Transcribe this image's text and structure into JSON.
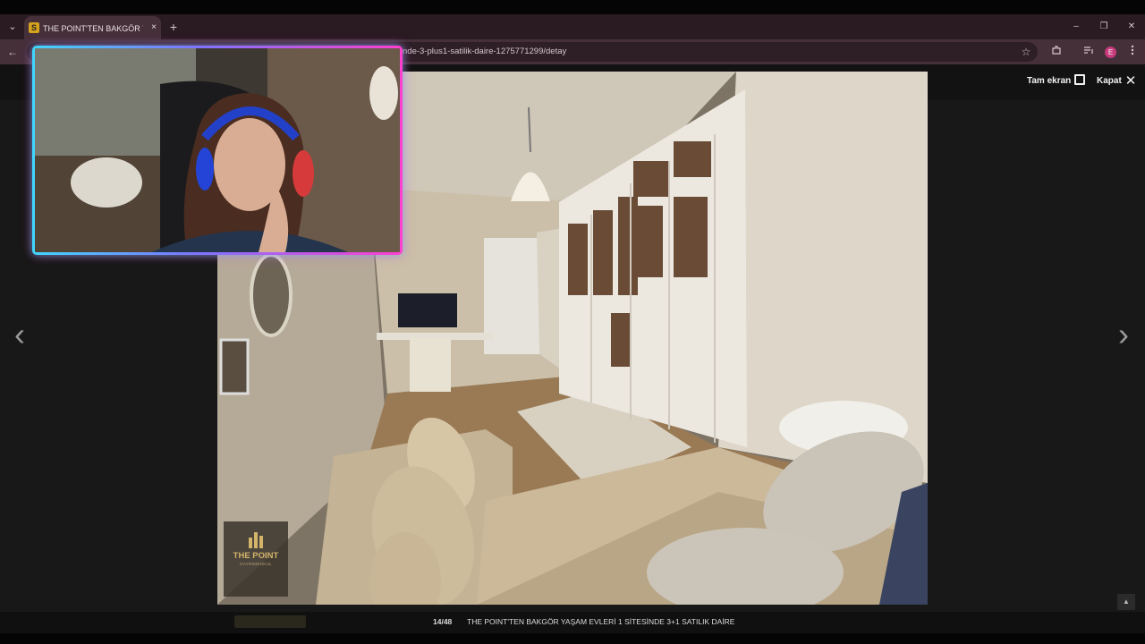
{
  "browser": {
    "tab": {
      "favicon_letter": "S",
      "title": "THE POINT'TEN BAKGÖR YAŞAM",
      "close_label": "×"
    },
    "new_tab_label": "+",
    "tab_list_label": "⌄",
    "window_controls": {
      "minimize": "–",
      "restore": "❐",
      "close": "✕"
    },
    "back_label": "←",
    "url": "nde-3-plus1-satilik-daire-1275771299/detay",
    "star_label": "☆",
    "profile_letter": "E"
  },
  "viewer": {
    "fullscreen_label": "Tam ekran",
    "close_label": "Kapat",
    "prev_label": "‹",
    "next_label": "›",
    "caption": {
      "counter": "14/48",
      "title": "THE POINT'TEN BAKGÖR YAŞAM EVLERİ 1 SİTESİNDE 3+1 SATILIK DAİRE"
    },
    "watermark": {
      "title": "THE POINT",
      "subtitle": "GAYRİMENKUL"
    },
    "scroll_top_label": "▲"
  },
  "colors": {
    "tab_strip": "#2a1a22",
    "toolbar": "#45303a",
    "viewer_bg": "#181818",
    "webcam_glow_left": "#41d7ff",
    "webcam_glow_right": "#ff3fd0",
    "watermark_gold": "#d4b46a"
  }
}
